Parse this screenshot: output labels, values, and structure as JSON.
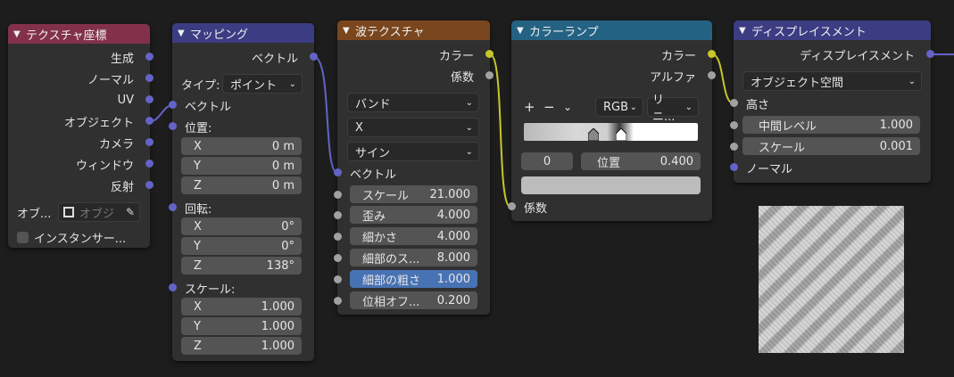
{
  "texture_coord": {
    "title": "テクスチャ座標",
    "outputs": [
      "生成",
      "ノーマル",
      "UV",
      "オブジェクト",
      "カメラ",
      "ウィンドウ",
      "反射"
    ],
    "object_label": "オブ...",
    "object_placeholder": "オブジ",
    "checkbox_label": "インスタンサー..."
  },
  "mapping": {
    "title": "マッピング",
    "out_vector": "ベクトル",
    "type_label": "タイプ:",
    "type_value": "ポイント",
    "in_vector": "ベクトル",
    "location_label": "位置:",
    "location": [
      {
        "axis": "X",
        "value": "0 m"
      },
      {
        "axis": "Y",
        "value": "0 m"
      },
      {
        "axis": "Z",
        "value": "0 m"
      }
    ],
    "rotation_label": "回転:",
    "rotation": [
      {
        "axis": "X",
        "value": "0°"
      },
      {
        "axis": "Y",
        "value": "0°"
      },
      {
        "axis": "Z",
        "value": "138°"
      }
    ],
    "scale_label": "スケール:",
    "scale": [
      {
        "axis": "X",
        "value": "1.000"
      },
      {
        "axis": "Y",
        "value": "1.000"
      },
      {
        "axis": "Z",
        "value": "1.000"
      }
    ]
  },
  "wave": {
    "title": "波テクスチャ",
    "out_color": "カラー",
    "out_fac": "係数",
    "dropdowns": [
      "バンド",
      "X",
      "サイン"
    ],
    "in_vector": "ベクトル",
    "fields": [
      {
        "label": "スケール",
        "value": "21.000"
      },
      {
        "label": "歪み",
        "value": "4.000"
      },
      {
        "label": "細かさ",
        "value": "4.000"
      },
      {
        "label": "細部のス...",
        "value": "8.000"
      },
      {
        "label": "細部の粗さ",
        "value": "1.000"
      },
      {
        "label": "位相オフ...",
        "value": "0.200"
      }
    ]
  },
  "colorramp": {
    "title": "カラーランプ",
    "out_color": "カラー",
    "out_alpha": "アルファ",
    "plus": "+",
    "minus": "−",
    "mode": "RGB",
    "interp": "リニ...",
    "index": "0",
    "pos_label": "位置",
    "pos_value": "0.400",
    "in_fac": "係数"
  },
  "displacement": {
    "title": "ディスプレイスメント",
    "out_disp": "ディスプレイスメント",
    "space": "オブジェクト空間",
    "in_height": "高さ",
    "fields": [
      {
        "label": "中間レベル",
        "value": "1.000"
      },
      {
        "label": "スケール",
        "value": "0.001"
      }
    ],
    "in_normal": "ノーマル"
  },
  "colors": {
    "texture_header": "#83314a",
    "vector_header": "#3c3c83",
    "texture2_header": "#79461d",
    "converter_header": "#246283",
    "vector_socket": "#6363c7",
    "color_socket": "#c7c729",
    "float_socket": "#a1a1a1",
    "selected_field": "#4772b3"
  }
}
